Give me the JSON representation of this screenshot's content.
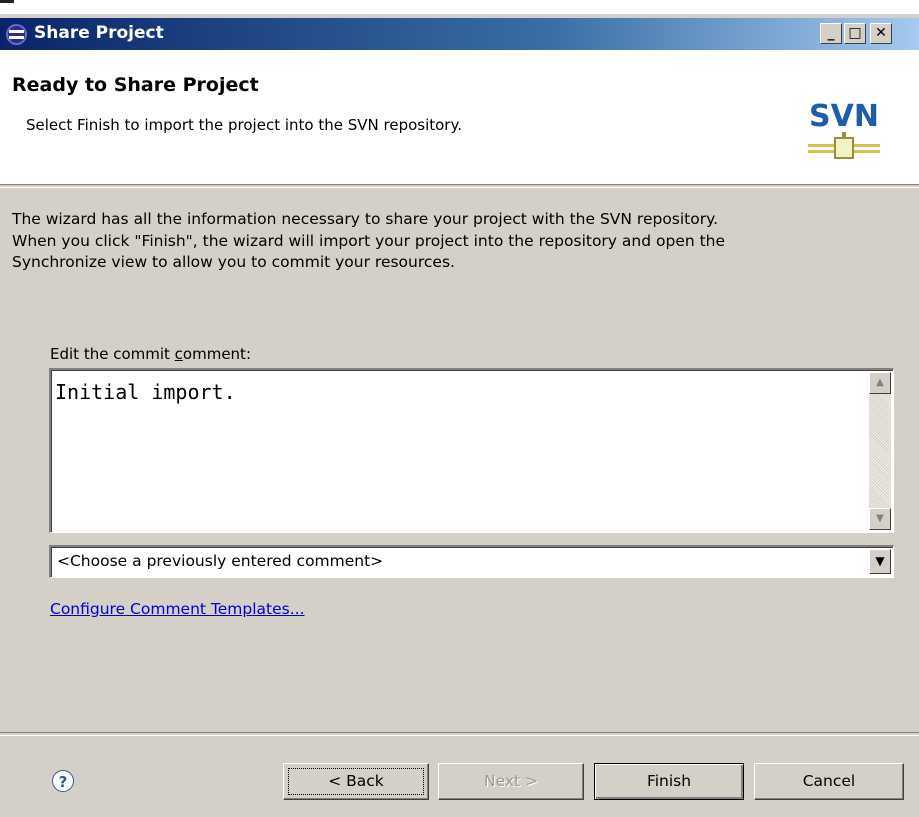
{
  "window": {
    "title": "Share Project",
    "controls": {
      "minimize": "_",
      "maximize": "□",
      "close": "✕"
    },
    "icon": "eclipse-icon"
  },
  "banner": {
    "title": "Ready to Share Project",
    "description": "Select Finish to import the project into the SVN repository.",
    "logo_text": "SVN"
  },
  "main": {
    "intro": "The wizard has all the information necessary to share your project with the SVN repository. When you click \"Finish\", the wizard will import your project into the repository and open the Synchronize view to allow you to commit your resources.",
    "comment_label_prefix": "Edit the commit ",
    "comment_label_mnemonic": "c",
    "comment_label_suffix": "omment:",
    "comment_value": "Initial import.",
    "previous_comment_placeholder": "<Choose a previously entered comment>",
    "configure_link": "Configure Comment Templates..."
  },
  "footer": {
    "help_icon": "help-icon",
    "help_glyph": "?",
    "back_label": "< Back",
    "next_label": "Next >",
    "finish_label": "Finish",
    "cancel_label": "Cancel"
  }
}
